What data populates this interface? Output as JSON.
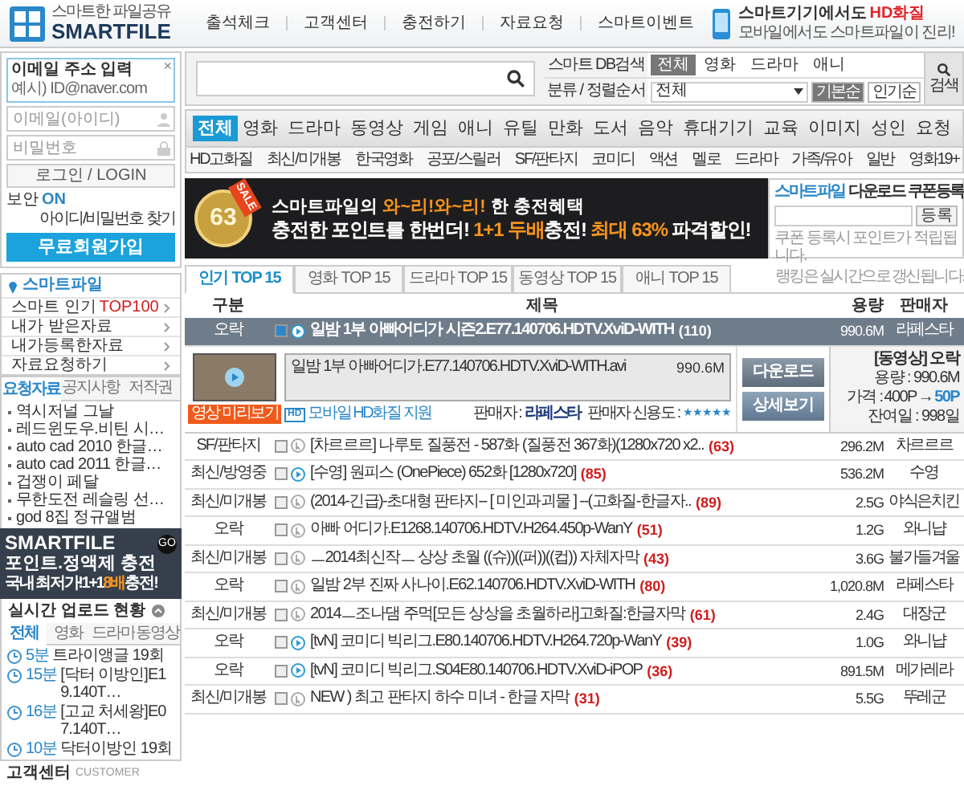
{
  "header": {
    "tagline": "스마트한 파일공유",
    "logo": "SMARTFILE",
    "nav": [
      "출석체크",
      "고객센터",
      "충전하기",
      "자료요청",
      "스마트이벤트"
    ],
    "promo_title": "스마트기기에서도",
    "promo_highlight": "HD화질",
    "promo_sub": "모바일에서도 스마트파일이 진리!"
  },
  "login": {
    "tip_label": "이메일 주소 입력",
    "tip_example": "예시) ID@naver.com",
    "close": "×",
    "email_placeholder": "이메일(아이디)",
    "password_placeholder": "비밀번호",
    "login_button": "로그인 / LOGIN",
    "secure_label": "보안",
    "secure_state": "ON",
    "find_link": "아이디/비밀번호 찾기",
    "signup_button": "무료회원가입"
  },
  "side_menu": {
    "title": "스마트파일",
    "items": [
      {
        "label": "스마트 인기",
        "badge": "TOP100"
      },
      {
        "label": "내가 받은자료"
      },
      {
        "label": "내가등록한자료"
      },
      {
        "label": "자료요청하기"
      }
    ]
  },
  "board": {
    "tabs": [
      {
        "label": "요청자료",
        "selected": true
      },
      {
        "label": "공지사항",
        "selected": false
      },
      {
        "label": "저작권",
        "selected": false
      }
    ],
    "items": [
      "역시저널 그날",
      "레드윈도우.비틴 시…",
      "auto cad 2010 한글…",
      "auto cad 2011 한글…",
      "겁쟁이 페달",
      "무한도전 레슬링 선…",
      "god 8집 정규앨범"
    ]
  },
  "side_banner": {
    "brand": "SMARTFILE",
    "line1": "포인트.정액제 충전",
    "line2_a": "국내 최저가!1+1",
    "line2_highlight": "8배",
    "line2_b": "충전!",
    "go": "GO"
  },
  "uploads": {
    "title": "실시간 업로드 현황",
    "tabs": [
      {
        "label": "전체",
        "selected": true
      },
      {
        "label": "영화",
        "selected": false
      },
      {
        "label": "드라마",
        "selected": false
      },
      {
        "label": "동영상",
        "selected": false
      }
    ],
    "items": [
      {
        "time": "5분",
        "title": "트라이앵글 19회"
      },
      {
        "time": "15분",
        "title": "[닥터 이방인]E19.140T…"
      },
      {
        "time": "16분",
        "title": "[고교 처세왕]E07.140T…"
      },
      {
        "time": "10분",
        "title": "닥터이방인 19회"
      }
    ]
  },
  "customer": {
    "title": "고객센터",
    "subtitle": "CUSTOMER"
  },
  "search": {
    "db_label": "스마트 DB검색",
    "filters": [
      {
        "label": "전체",
        "selected": true
      },
      {
        "label": "영화",
        "selected": false
      },
      {
        "label": "드라마",
        "selected": false
      },
      {
        "label": "애니",
        "selected": false
      }
    ],
    "sort_label": "분류 / 정렬순서",
    "category_select": "전체",
    "sort_buttons": [
      {
        "label": "기본순",
        "selected": true
      },
      {
        "label": "인기순",
        "selected": false
      }
    ],
    "search_button": "검색"
  },
  "categories": [
    {
      "label": "전체",
      "selected": true
    },
    {
      "label": "영화",
      "selected": false
    },
    {
      "label": "드라마",
      "selected": false
    },
    {
      "label": "동영상",
      "selected": false
    },
    {
      "label": "게임",
      "selected": false
    },
    {
      "label": "애니",
      "selected": false
    },
    {
      "label": "유틸",
      "selected": false
    },
    {
      "label": "만화",
      "selected": false
    },
    {
      "label": "도서",
      "selected": false
    },
    {
      "label": "음악",
      "selected": false
    },
    {
      "label": "휴대기기",
      "selected": false
    },
    {
      "label": "교육",
      "selected": false
    },
    {
      "label": "이미지",
      "selected": false
    },
    {
      "label": "성인",
      "selected": false
    },
    {
      "label": "요청",
      "selected": false
    }
  ],
  "subcategories": [
    "HD고화질",
    "최신/미개봉",
    "한국영화",
    "공포/스릴러",
    "SF/판타지",
    "코미디",
    "액션",
    "멜로",
    "드라마",
    "가족/유아",
    "일반",
    "영화19+"
  ],
  "banner": {
    "medal_number": "63",
    "medal_tag": "SALE",
    "line1": [
      {
        "text": "스마트파일의 ",
        "highlight": false
      },
      {
        "text": "와~리!와~리!",
        "highlight": true
      },
      {
        "text": " 한 충전혜택",
        "highlight": false
      }
    ],
    "line2": [
      {
        "text": "충전한 포인트를 한번더! ",
        "highlight": false
      },
      {
        "text": "1+1 두배",
        "highlight": true
      },
      {
        "text": "충전! ",
        "highlight": false
      },
      {
        "text": "최대 63%",
        "highlight": true
      },
      {
        "text": " 파격할인!",
        "highlight": false
      }
    ]
  },
  "coupon": {
    "title_brand": "스마트파일",
    "title": "다운로드 쿠폰등록",
    "button": "등록",
    "note": "쿠폰 등록시 포인트가 적립됩니다."
  },
  "ranking": {
    "tabs": [
      {
        "label": "인기 TOP 15",
        "selected": true
      },
      {
        "label": "영화 TOP 15",
        "selected": false
      },
      {
        "label": "드라마 TOP 15",
        "selected": false
      },
      {
        "label": "동영상 TOP 15",
        "selected": false
      },
      {
        "label": "애니 TOP 15",
        "selected": false
      }
    ],
    "note": "랭킹은 실시간으로 갱신됩니다.",
    "columns": [
      "구분",
      "제목",
      "용량",
      "판매자"
    ],
    "rows": [
      {
        "category": "오락",
        "title": "일밤 1부 아빠어디가 시즌2.E77.140706.HDTV.XviD-WITH",
        "count": "(110)",
        "size": "990.6M",
        "seller": "라페스타",
        "preview": true,
        "expanded": true
      },
      {
        "category": "SF/판타지",
        "title": "[차르르르] 나루토 질풍전 - 587화 (질풍전 367화)(1280x720 x2..",
        "count": "(63)",
        "size": "296.2M",
        "seller": "차르르르",
        "preview": false,
        "expanded": false
      },
      {
        "category": "최신/방영중",
        "title": "[수영] 원피스 (OnePiece) 652화 [1280x720]",
        "count": "(85)",
        "size": "536.2M",
        "seller": "수영",
        "preview": true,
        "expanded": false
      },
      {
        "category": "최신/미개봉",
        "title": "(2014-긴급)-초대형 판타지-- [ 미인과괴물 ] --(고화질-한글자..",
        "count": "(89)",
        "size": "2.5G",
        "seller": "야식은치킨",
        "preview": false,
        "expanded": false
      },
      {
        "category": "오락",
        "title": "아빠 어디가.E1268.140706.HDTV.H264.450p-WanY",
        "count": "(51)",
        "size": "1.2G",
        "seller": "와니냡",
        "preview": false,
        "expanded": false
      },
      {
        "category": "최신/미개봉",
        "title": "ㅡ2014최신작ㅡ 상상 초월 ((슈))((퍼))((컵)) 자체자막",
        "count": "(43)",
        "size": "3.6G",
        "seller": "불가들겨울",
        "preview": false,
        "expanded": false
      },
      {
        "category": "오락",
        "title": "일밤 2부 진짜 사나이.E62.140706.HDTV.XviD-WITH",
        "count": "(80)",
        "size": "1,020.8M",
        "seller": "라페스타",
        "preview": false,
        "expanded": false
      },
      {
        "category": "최신/미개봉",
        "title": "2014ㅡ조나댐 주먹[모든 상상을 초월하라]고화질:한글자막",
        "count": "(61)",
        "size": "2.4G",
        "seller": "대장군",
        "preview": false,
        "expanded": false
      },
      {
        "category": "오락",
        "title": "[tvN] 코미디 빅리그.E80.140706.HDTV.H264.720p-WanY",
        "count": "(39)",
        "size": "1.0G",
        "seller": "와니냡",
        "preview": true,
        "expanded": false
      },
      {
        "category": "오락",
        "title": "[tvN] 코미디 빅리그.S04E80.140706.HDTV.XviD-iPOP",
        "count": "(36)",
        "size": "891.5M",
        "seller": "메가레라",
        "preview": true,
        "expanded": false
      },
      {
        "category": "최신/미개봉",
        "title": "NEW ) 최고 판타지 하수 미녀 - 한글 자막",
        "count": "(31)",
        "size": "5.5G",
        "seller": "뚜레군",
        "preview": false,
        "expanded": false
      }
    ],
    "detail": {
      "file_name": "일밤 1부 아빠어디가.E77.140706.HDTV.XviD-WITH.avi",
      "file_size": "990.6M",
      "preview_button": "영상 미리보기",
      "hd_badge": "HD",
      "hd_text": "모바일 HD화질 지원",
      "seller_label": "판매자 :",
      "seller": "라페스타",
      "rating_label": "판매자 신용도 :",
      "stars": 5,
      "download_button": "다운로드",
      "view_button": "상세보기",
      "info_type": "[동영상] 오락",
      "info_size": "용량 : 990.6M",
      "price_label": "가격 :",
      "price_old": "400P",
      "price_arrow": "→",
      "price_new": "50P",
      "info_days": "잔여일 : 998일"
    }
  }
}
